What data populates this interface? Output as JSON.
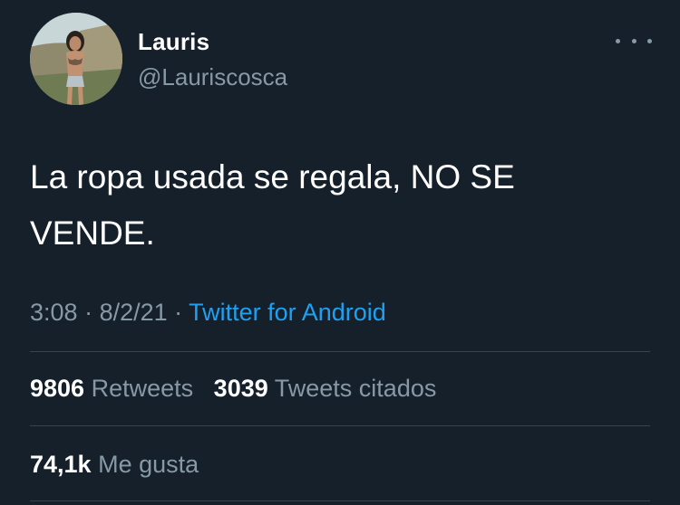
{
  "author": {
    "display_name": "Lauris",
    "handle": "@Lauriscosca"
  },
  "tweet": {
    "text": "La ropa usada se regala, NO SE VENDE."
  },
  "meta": {
    "time": "3:08",
    "sep1": " · ",
    "date": "8/2/21",
    "sep2": " · ",
    "source": "Twitter for Android"
  },
  "stats": {
    "retweets_count": "9806",
    "retweets_label": "Retweets",
    "quotes_count": "3039",
    "quotes_label": "Tweets citados",
    "likes_count": "74,1k",
    "likes_label": "Me gusta"
  },
  "colors": {
    "background": "#15202b",
    "text": "#ffffff",
    "muted": "#8899a6",
    "link": "#1da1f2",
    "divider": "#38444d"
  },
  "icons": {
    "more": "more-horizontal-icon"
  }
}
